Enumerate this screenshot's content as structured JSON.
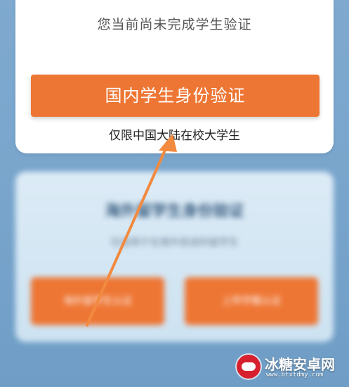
{
  "verification": {
    "status_text": "您当前尚未完成学生验证",
    "domestic_button_label": "国内学生身份验证",
    "domestic_hint": "仅限中国大陆在校大学生"
  },
  "overseas_blurred": {
    "title": "海外留学生身份验证",
    "subtitle": "仅适用于在境外就读的留学生",
    "left_button": "海外留学生认证",
    "right_button": "上传学籍认证"
  },
  "annotation": {
    "arrow_color": "#f28a3f"
  },
  "watermark": {
    "brand": "冰糖安卓网",
    "url": "www.btxtdmy.com"
  },
  "colors": {
    "accent": "#ee7634",
    "background": "#7fa9cf"
  }
}
